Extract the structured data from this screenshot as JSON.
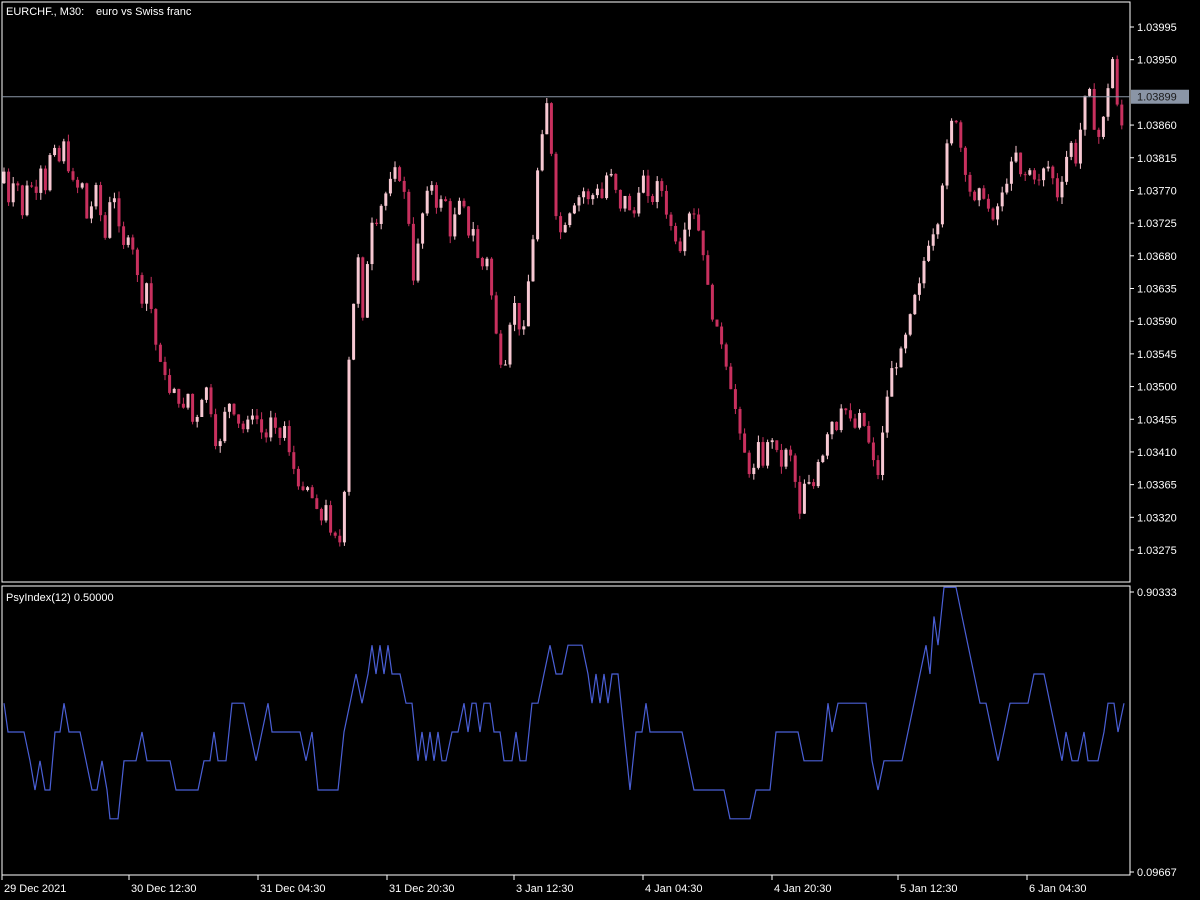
{
  "header": {
    "symbol": "EURCHF., M30:",
    "description": "euro vs Swiss franc"
  },
  "indicator": {
    "title": "PsyIndex(12) 0.50000"
  },
  "colors": {
    "background": "#000000",
    "frame": "#ffffff",
    "bull_candle": "#f7c8d2",
    "bear_candle": "#c8305e",
    "indicator_line": "#4a5fd6",
    "current_price_line": "#8a95a6",
    "current_price_box": "#8a95a6"
  },
  "chart_data": [
    {
      "type": "candlestick",
      "current_price": "1.03899",
      "y_ticks": [
        "1.03995",
        "1.03950",
        "1.03860",
        "1.03815",
        "1.03770",
        "1.03725",
        "1.03680",
        "1.03635",
        "1.03590",
        "1.03545",
        "1.03500",
        "1.03455",
        "1.03410",
        "1.03365",
        "1.03320",
        "1.03275"
      ],
      "ylim": [
        1.0325,
        1.0402
      ],
      "path": [
        [
          0,
          1.0378
        ],
        [
          5,
          1.038
        ],
        [
          10,
          1.0374
        ],
        [
          15,
          1.0381
        ],
        [
          22,
          1.0373
        ],
        [
          28,
          1.0379
        ],
        [
          35,
          1.0376
        ],
        [
          40,
          1.0381
        ],
        [
          46,
          1.0377
        ],
        [
          52,
          1.0384
        ],
        [
          58,
          1.038
        ],
        [
          63,
          1.0384
        ],
        [
          70,
          1.0379
        ],
        [
          76,
          1.0377
        ],
        [
          82,
          1.0378
        ],
        [
          88,
          1.0372
        ],
        [
          95,
          1.0378
        ],
        [
          100,
          1.0374
        ],
        [
          106,
          1.037
        ],
        [
          112,
          1.0379
        ],
        [
          118,
          1.0372
        ],
        [
          124,
          1.0369
        ],
        [
          130,
          1.0372
        ],
        [
          136,
          1.0366
        ],
        [
          142,
          1.0362
        ],
        [
          148,
          1.0365
        ],
        [
          154,
          1.0357
        ],
        [
          160,
          1.0353
        ],
        [
          165,
          1.0352
        ],
        [
          171,
          1.0348
        ],
        [
          176,
          1.035
        ],
        [
          182,
          1.0346
        ],
        [
          188,
          1.0349
        ],
        [
          194,
          1.0344
        ],
        [
          200,
          1.0348
        ],
        [
          206,
          1.035
        ],
        [
          212,
          1.0346
        ],
        [
          218,
          1.034
        ],
        [
          224,
          1.0346
        ],
        [
          230,
          1.0348
        ],
        [
          236,
          1.0346
        ],
        [
          242,
          1.0344
        ],
        [
          248,
          1.0345
        ],
        [
          254,
          1.0347
        ],
        [
          260,
          1.0344
        ],
        [
          266,
          1.0343
        ],
        [
          272,
          1.0346
        ],
        [
          278,
          1.0342
        ],
        [
          284,
          1.0345
        ],
        [
          290,
          1.034
        ],
        [
          296,
          1.0338
        ],
        [
          302,
          1.0335
        ],
        [
          308,
          1.0336
        ],
        [
          314,
          1.0334
        ],
        [
          320,
          1.0331
        ],
        [
          326,
          1.0334
        ],
        [
          332,
          1.0328
        ],
        [
          338,
          1.033
        ],
        [
          342,
          1.0327
        ],
        [
          346,
          1.0342
        ],
        [
          350,
          1.0358
        ],
        [
          354,
          1.0362
        ],
        [
          358,
          1.0368
        ],
        [
          362,
          1.0358
        ],
        [
          366,
          1.0363
        ],
        [
          370,
          1.0375
        ],
        [
          374,
          1.0371
        ],
        [
          378,
          1.0374
        ],
        [
          384,
          1.0376
        ],
        [
          390,
          1.0378
        ],
        [
          396,
          1.038
        ],
        [
          402,
          1.0378
        ],
        [
          408,
          1.0374
        ],
        [
          414,
          1.0364
        ],
        [
          420,
          1.0372
        ],
        [
          426,
          1.0376
        ],
        [
          432,
          1.0378
        ],
        [
          438,
          1.0374
        ],
        [
          444,
          1.0377
        ],
        [
          450,
          1.0371
        ],
        [
          456,
          1.0374
        ],
        [
          462,
          1.0376
        ],
        [
          468,
          1.0371
        ],
        [
          474,
          1.0372
        ],
        [
          480,
          1.0365
        ],
        [
          486,
          1.0369
        ],
        [
          492,
          1.0362
        ],
        [
          498,
          1.0355
        ],
        [
          504,
          1.0352
        ],
        [
          510,
          1.0359
        ],
        [
          516,
          1.0362
        ],
        [
          522,
          1.0355
        ],
        [
          528,
          1.0364
        ],
        [
          532,
          1.0368
        ],
        [
          536,
          1.0378
        ],
        [
          540,
          1.0382
        ],
        [
          544,
          1.0386
        ],
        [
          548,
          1.039
        ],
        [
          552,
          1.0381
        ],
        [
          556,
          1.0374
        ],
        [
          560,
          1.0371
        ],
        [
          566,
          1.0373
        ],
        [
          572,
          1.0375
        ],
        [
          578,
          1.0376
        ],
        [
          584,
          1.0377
        ],
        [
          590,
          1.0375
        ],
        [
          596,
          1.0378
        ],
        [
          602,
          1.0376
        ],
        [
          608,
          1.038
        ],
        [
          614,
          1.0378
        ],
        [
          620,
          1.0374
        ],
        [
          626,
          1.0377
        ],
        [
          632,
          1.0372
        ],
        [
          638,
          1.0377
        ],
        [
          644,
          1.0379
        ],
        [
          650,
          1.0374
        ],
        [
          656,
          1.0378
        ],
        [
          662,
          1.0377
        ],
        [
          668,
          1.0373
        ],
        [
          674,
          1.0371
        ],
        [
          680,
          1.0369
        ],
        [
          686,
          1.0373
        ],
        [
          692,
          1.0375
        ],
        [
          698,
          1.0372
        ],
        [
          704,
          1.0368
        ],
        [
          710,
          1.0361
        ],
        [
          716,
          1.0358
        ],
        [
          722,
          1.0356
        ],
        [
          728,
          1.0352
        ],
        [
          734,
          1.0348
        ],
        [
          740,
          1.0343
        ],
        [
          746,
          1.034
        ],
        [
          752,
          1.0337
        ],
        [
          758,
          1.0342
        ],
        [
          764,
          1.0339
        ],
        [
          770,
          1.0344
        ],
        [
          776,
          1.0341
        ],
        [
          782,
          1.0339
        ],
        [
          788,
          1.0342
        ],
        [
          794,
          1.0338
        ],
        [
          800,
          1.0332
        ],
        [
          806,
          1.0338
        ],
        [
          812,
          1.0335
        ],
        [
          818,
          1.034
        ],
        [
          824,
          1.0341
        ],
        [
          830,
          1.0346
        ],
        [
          836,
          1.0344
        ],
        [
          842,
          1.0348
        ],
        [
          848,
          1.0346
        ],
        [
          854,
          1.0344
        ],
        [
          860,
          1.0346
        ],
        [
          866,
          1.0344
        ],
        [
          872,
          1.034
        ],
        [
          878,
          1.0338
        ],
        [
          884,
          1.0345
        ],
        [
          890,
          1.0352
        ],
        [
          896,
          1.0353
        ],
        [
          902,
          1.0355
        ],
        [
          908,
          1.0358
        ],
        [
          914,
          1.0362
        ],
        [
          920,
          1.0364
        ],
        [
          926,
          1.0369
        ],
        [
          932,
          1.0371
        ],
        [
          938,
          1.0373
        ],
        [
          944,
          1.038
        ],
        [
          950,
          1.0386
        ],
        [
          956,
          1.0387
        ],
        [
          962,
          1.0382
        ],
        [
          968,
          1.0378
        ],
        [
          974,
          1.0375
        ],
        [
          980,
          1.0377
        ],
        [
          986,
          1.0376
        ],
        [
          992,
          1.0372
        ],
        [
          998,
          1.0375
        ],
        [
          1004,
          1.0377
        ],
        [
          1010,
          1.038
        ],
        [
          1016,
          1.0382
        ],
        [
          1022,
          1.0378
        ],
        [
          1028,
          1.038
        ],
        [
          1034,
          1.0379
        ],
        [
          1040,
          1.0378
        ],
        [
          1046,
          1.0381
        ],
        [
          1052,
          1.0379
        ],
        [
          1058,
          1.0376
        ],
        [
          1064,
          1.038
        ],
        [
          1070,
          1.0384
        ],
        [
          1076,
          1.0381
        ],
        [
          1082,
          1.0387
        ],
        [
          1088,
          1.0392
        ],
        [
          1094,
          1.0386
        ],
        [
          1100,
          1.0384
        ],
        [
          1106,
          1.0389
        ],
        [
          1112,
          1.0396
        ],
        [
          1116,
          1.039
        ],
        [
          1120,
          1.0385
        ],
        [
          1124,
          1.0387
        ]
      ]
    },
    {
      "type": "line",
      "name": "PsyIndex(12)",
      "y_ticks": [
        "0.90333",
        "0.09667"
      ],
      "ylim": [
        0.09667,
        0.90333
      ],
      "x_ticks": [
        "29 Dec 2021",
        "30 Dec 12:30",
        "31 Dec 04:30",
        "31 Dec 20:30",
        "3 Jan 12:30",
        "4 Jan 04:30",
        "4 Jan 20:30",
        "5 Jan 12:30",
        "6 Jan 04:30"
      ],
      "path": [
        [
          4,
          0.583
        ],
        [
          8,
          0.5
        ],
        [
          24,
          0.5
        ],
        [
          30,
          0.417
        ],
        [
          35,
          0.333
        ],
        [
          40,
          0.417
        ],
        [
          45,
          0.333
        ],
        [
          50,
          0.333
        ],
        [
          55,
          0.5
        ],
        [
          60,
          0.5
        ],
        [
          64,
          0.583
        ],
        [
          69,
          0.5
        ],
        [
          80,
          0.5
        ],
        [
          86,
          0.417
        ],
        [
          92,
          0.333
        ],
        [
          97,
          0.333
        ],
        [
          102,
          0.417
        ],
        [
          107,
          0.333
        ],
        [
          110,
          0.25
        ],
        [
          118,
          0.25
        ],
        [
          124,
          0.417
        ],
        [
          136,
          0.417
        ],
        [
          142,
          0.5
        ],
        [
          147,
          0.417
        ],
        [
          170,
          0.417
        ],
        [
          176,
          0.333
        ],
        [
          198,
          0.333
        ],
        [
          204,
          0.417
        ],
        [
          210,
          0.417
        ],
        [
          214,
          0.5
        ],
        [
          218,
          0.417
        ],
        [
          226,
          0.417
        ],
        [
          232,
          0.583
        ],
        [
          244,
          0.583
        ],
        [
          250,
          0.5
        ],
        [
          256,
          0.417
        ],
        [
          262,
          0.5
        ],
        [
          268,
          0.583
        ],
        [
          272,
          0.5
        ],
        [
          300,
          0.5
        ],
        [
          306,
          0.417
        ],
        [
          312,
          0.5
        ],
        [
          318,
          0.333
        ],
        [
          338,
          0.333
        ],
        [
          344,
          0.5
        ],
        [
          350,
          0.583
        ],
        [
          356,
          0.667
        ],
        [
          362,
          0.583
        ],
        [
          368,
          0.667
        ],
        [
          372,
          0.75
        ],
        [
          376,
          0.667
        ],
        [
          380,
          0.75
        ],
        [
          384,
          0.667
        ],
        [
          388,
          0.75
        ],
        [
          392,
          0.667
        ],
        [
          400,
          0.667
        ],
        [
          406,
          0.583
        ],
        [
          412,
          0.583
        ],
        [
          418,
          0.417
        ],
        [
          422,
          0.5
        ],
        [
          426,
          0.417
        ],
        [
          430,
          0.5
        ],
        [
          434,
          0.417
        ],
        [
          438,
          0.5
        ],
        [
          442,
          0.417
        ],
        [
          446,
          0.417
        ],
        [
          452,
          0.5
        ],
        [
          458,
          0.5
        ],
        [
          464,
          0.583
        ],
        [
          468,
          0.5
        ],
        [
          472,
          0.583
        ],
        [
          476,
          0.583
        ],
        [
          480,
          0.5
        ],
        [
          484,
          0.583
        ],
        [
          490,
          0.583
        ],
        [
          494,
          0.5
        ],
        [
          500,
          0.5
        ],
        [
          504,
          0.417
        ],
        [
          512,
          0.417
        ],
        [
          516,
          0.5
        ],
        [
          520,
          0.417
        ],
        [
          526,
          0.417
        ],
        [
          532,
          0.583
        ],
        [
          538,
          0.583
        ],
        [
          544,
          0.667
        ],
        [
          550,
          0.75
        ],
        [
          556,
          0.667
        ],
        [
          562,
          0.667
        ],
        [
          568,
          0.75
        ],
        [
          582,
          0.75
        ],
        [
          588,
          0.667
        ],
        [
          592,
          0.583
        ],
        [
          596,
          0.667
        ],
        [
          600,
          0.583
        ],
        [
          604,
          0.667
        ],
        [
          608,
          0.583
        ],
        [
          612,
          0.667
        ],
        [
          618,
          0.667
        ],
        [
          624,
          0.5
        ],
        [
          630,
          0.333
        ],
        [
          636,
          0.5
        ],
        [
          642,
          0.5
        ],
        [
          646,
          0.583
        ],
        [
          650,
          0.5
        ],
        [
          682,
          0.5
        ],
        [
          688,
          0.417
        ],
        [
          694,
          0.333
        ],
        [
          724,
          0.333
        ],
        [
          730,
          0.25
        ],
        [
          750,
          0.25
        ],
        [
          756,
          0.333
        ],
        [
          770,
          0.333
        ],
        [
          776,
          0.5
        ],
        [
          798,
          0.5
        ],
        [
          804,
          0.417
        ],
        [
          822,
          0.417
        ],
        [
          828,
          0.583
        ],
        [
          832,
          0.5
        ],
        [
          838,
          0.583
        ],
        [
          844,
          0.583
        ],
        [
          850,
          0.583
        ],
        [
          866,
          0.583
        ],
        [
          872,
          0.417
        ],
        [
          878,
          0.333
        ],
        [
          884,
          0.417
        ],
        [
          902,
          0.417
        ],
        [
          908,
          0.5
        ],
        [
          914,
          0.583
        ],
        [
          920,
          0.667
        ],
        [
          926,
          0.75
        ],
        [
          930,
          0.667
        ],
        [
          934,
          0.833
        ],
        [
          938,
          0.75
        ],
        [
          944,
          0.917
        ],
        [
          956,
          0.917
        ],
        [
          962,
          0.833
        ],
        [
          968,
          0.75
        ],
        [
          974,
          0.667
        ],
        [
          980,
          0.583
        ],
        [
          986,
          0.583
        ],
        [
          992,
          0.5
        ],
        [
          998,
          0.417
        ],
        [
          1004,
          0.5
        ],
        [
          1010,
          0.583
        ],
        [
          1028,
          0.583
        ],
        [
          1034,
          0.667
        ],
        [
          1044,
          0.667
        ],
        [
          1050,
          0.583
        ],
        [
          1056,
          0.5
        ],
        [
          1062,
          0.417
        ],
        [
          1066,
          0.5
        ],
        [
          1072,
          0.417
        ],
        [
          1078,
          0.417
        ],
        [
          1084,
          0.5
        ],
        [
          1088,
          0.417
        ],
        [
          1098,
          0.417
        ],
        [
          1104,
          0.5
        ],
        [
          1108,
          0.583
        ],
        [
          1114,
          0.583
        ],
        [
          1118,
          0.5
        ],
        [
          1124,
          0.583
        ]
      ]
    }
  ]
}
